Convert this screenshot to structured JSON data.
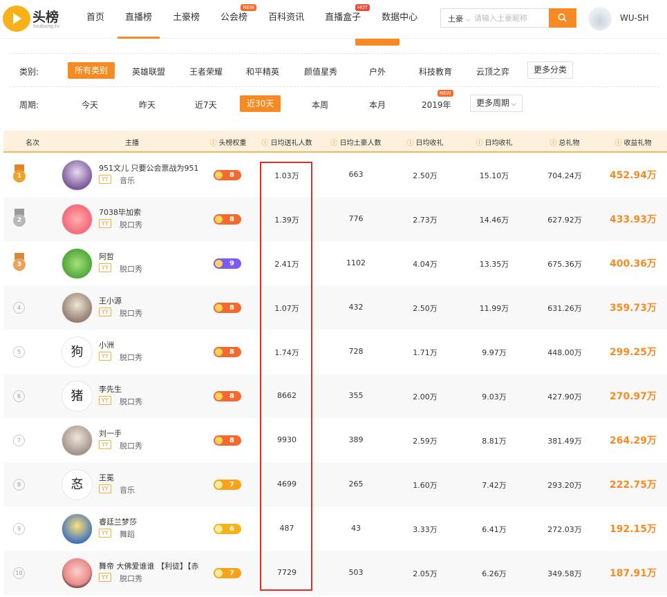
{
  "logo": {
    "text": "头榜",
    "sub": "toubang.tv"
  },
  "nav": [
    {
      "label": "首页",
      "tag": ""
    },
    {
      "label": "直播榜",
      "tag": "",
      "active": true
    },
    {
      "label": "土豪榜",
      "tag": ""
    },
    {
      "label": "公会榜",
      "tag": "NEW"
    },
    {
      "label": "百科资讯",
      "tag": ""
    },
    {
      "label": "直播盒子",
      "tag": "HOT"
    },
    {
      "label": "数据中心",
      "tag": ""
    }
  ],
  "search": {
    "select": "土豪",
    "placeholder": "请输入土豪昵称"
  },
  "user": {
    "name": "WU-SH"
  },
  "filters": {
    "category": {
      "label": "类别:",
      "items": [
        "所有类别",
        "英雄联盟",
        "王者荣耀",
        "和平精英",
        "颜值星秀",
        "户外",
        "科技教育",
        "云顶之弈"
      ],
      "more": "更多分类"
    },
    "period": {
      "label": "周期:",
      "items": [
        "今天",
        "昨天",
        "近7天",
        "近30天",
        "本周",
        "本月",
        "2019年"
      ],
      "new_tag": "NEW",
      "more": "更多周期"
    }
  },
  "table": {
    "headers": [
      "名次",
      "主播",
      "头榜权重",
      "日均送礼人数",
      "日均土豪人数",
      "日均收礼",
      "日均收礼",
      "总礼物",
      "收益礼物"
    ],
    "rows": [
      {
        "rank": "1",
        "name": "951文儿 只要公会票战为951",
        "platform": "YY",
        "category": "音乐",
        "level": "8",
        "gifters": "1.03万",
        "tycoons": "663",
        "hourly": "2.50万",
        "daily": "15.10万",
        "total": "704.24万",
        "revenue": "452.94万"
      },
      {
        "rank": "2",
        "name": "7038毕加索",
        "platform": "YY",
        "category": "脱口秀",
        "level": "8",
        "gifters": "1.39万",
        "tycoons": "776",
        "hourly": "2.73万",
        "daily": "14.46万",
        "total": "627.92万",
        "revenue": "433.93万"
      },
      {
        "rank": "3",
        "name": "阿哲",
        "platform": "YY",
        "category": "脱口秀",
        "level": "9",
        "gifters": "2.41万",
        "tycoons": "1102",
        "hourly": "4.04万",
        "daily": "13.35万",
        "total": "675.36万",
        "revenue": "400.36万"
      },
      {
        "rank": "4",
        "name": "王小源",
        "platform": "YY",
        "category": "脱口秀",
        "level": "8",
        "gifters": "1.07万",
        "tycoons": "432",
        "hourly": "2.50万",
        "daily": "11.99万",
        "total": "631.26万",
        "revenue": "359.73万"
      },
      {
        "rank": "5",
        "name": "小洲",
        "platform": "YY",
        "category": "脱口秀",
        "level": "8",
        "gifters": "1.74万",
        "tycoons": "728",
        "hourly": "1.71万",
        "daily": "9.97万",
        "total": "448.00万",
        "revenue": "299.25万"
      },
      {
        "rank": "6",
        "name": "李先生",
        "platform": "YY",
        "category": "脱口秀",
        "level": "8",
        "gifters": "8662",
        "tycoons": "355",
        "hourly": "2.00万",
        "daily": "9.03万",
        "total": "427.90万",
        "revenue": "270.97万"
      },
      {
        "rank": "7",
        "name": "刘一手",
        "platform": "YY",
        "category": "脱口秀",
        "level": "8",
        "gifters": "9930",
        "tycoons": "389",
        "hourly": "2.59万",
        "daily": "8.81万",
        "total": "381.49万",
        "revenue": "264.29万"
      },
      {
        "rank": "8",
        "name": "王冕",
        "platform": "YY",
        "category": "音乐",
        "level": "7",
        "gifters": "4699",
        "tycoons": "265",
        "hourly": "1.60万",
        "daily": "7.42万",
        "total": "293.20万",
        "revenue": "222.75万"
      },
      {
        "rank": "9",
        "name": "睿廷兰梦莎",
        "platform": "YY",
        "category": "舞蹈",
        "level": "6",
        "gifters": "487",
        "tycoons": "43",
        "hourly": "3.33万",
        "daily": "6.41万",
        "total": "272.03万",
        "revenue": "192.15万"
      },
      {
        "rank": "10",
        "name": "舞帝 大佛爱谁谁 【利徒】【赤",
        "platform": "YY",
        "category": "脱口秀",
        "level": "7",
        "gifters": "7729",
        "tycoons": "503",
        "hourly": "2.05万",
        "daily": "6.26万",
        "total": "349.58万",
        "revenue": "187.91万"
      }
    ]
  },
  "colors": {
    "accent": "#f78b23",
    "highlight_box": "#e02b2b",
    "header_bg": "#fdf0dc"
  }
}
